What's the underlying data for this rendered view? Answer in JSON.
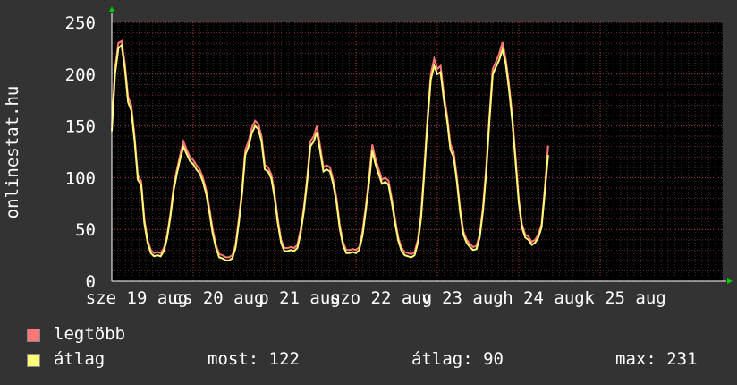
{
  "chart_data": {
    "type": "line",
    "ylabel": "onlinestat.hu",
    "ylim": [
      0,
      250
    ],
    "yticks": [
      0,
      50,
      100,
      150,
      200,
      250
    ],
    "xticks": [
      {
        "text": "sze 19 aug",
        "day": 0
      },
      {
        "text": "cs 20 aug",
        "day": 1
      },
      {
        "text": "p 21 aug",
        "day": 2
      },
      {
        "text": "szo 22 aug",
        "day": 3
      },
      {
        "text": "v 23 aug",
        "day": 4
      },
      {
        "text": "h 24 aug",
        "day": 5
      },
      {
        "text": "k 25 aug",
        "day": 6
      }
    ],
    "grid": true,
    "colors": {
      "background": "#333333",
      "plot_bg": "#000000",
      "grid": "#5a5a5a",
      "minor_grid": "#8a3030",
      "axis": "#ffffff",
      "arrow": "#00cc00",
      "max_series": "#ff7777",
      "avg_series": "#ffff77"
    },
    "series": [
      {
        "name": "legtöbb",
        "color": "#ff7777",
        "points": [
          [
            0.0,
            150
          ],
          [
            0.04,
            205
          ],
          [
            0.08,
            230
          ],
          [
            0.12,
            232
          ],
          [
            0.16,
            210
          ],
          [
            0.2,
            178
          ],
          [
            0.24,
            170
          ],
          [
            0.28,
            140
          ],
          [
            0.32,
            102
          ],
          [
            0.36,
            97
          ],
          [
            0.4,
            60
          ],
          [
            0.44,
            40
          ],
          [
            0.48,
            30
          ],
          [
            0.52,
            27
          ],
          [
            0.56,
            28
          ],
          [
            0.6,
            27
          ],
          [
            0.64,
            32
          ],
          [
            0.68,
            45
          ],
          [
            0.72,
            65
          ],
          [
            0.76,
            92
          ],
          [
            0.8,
            108
          ],
          [
            0.84,
            122
          ],
          [
            0.88,
            135
          ],
          [
            0.92,
            127
          ],
          [
            0.96,
            120
          ],
          [
            1.0,
            117
          ],
          [
            1.04,
            112
          ],
          [
            1.08,
            108
          ],
          [
            1.12,
            100
          ],
          [
            1.16,
            88
          ],
          [
            1.2,
            70
          ],
          [
            1.24,
            50
          ],
          [
            1.28,
            35
          ],
          [
            1.32,
            26
          ],
          [
            1.36,
            25
          ],
          [
            1.4,
            23
          ],
          [
            1.44,
            23
          ],
          [
            1.48,
            25
          ],
          [
            1.52,
            35
          ],
          [
            1.56,
            60
          ],
          [
            1.6,
            88
          ],
          [
            1.64,
            127
          ],
          [
            1.68,
            135
          ],
          [
            1.72,
            148
          ],
          [
            1.76,
            155
          ],
          [
            1.8,
            152
          ],
          [
            1.84,
            140
          ],
          [
            1.88,
            112
          ],
          [
            1.92,
            110
          ],
          [
            1.96,
            103
          ],
          [
            2.0,
            85
          ],
          [
            2.04,
            60
          ],
          [
            2.08,
            40
          ],
          [
            2.12,
            32
          ],
          [
            2.16,
            32
          ],
          [
            2.2,
            33
          ],
          [
            2.24,
            32
          ],
          [
            2.28,
            35
          ],
          [
            2.32,
            50
          ],
          [
            2.36,
            72
          ],
          [
            2.4,
            100
          ],
          [
            2.44,
            135
          ],
          [
            2.48,
            140
          ],
          [
            2.52,
            150
          ],
          [
            2.56,
            130
          ],
          [
            2.6,
            110
          ],
          [
            2.64,
            112
          ],
          [
            2.68,
            110
          ],
          [
            2.72,
            98
          ],
          [
            2.76,
            80
          ],
          [
            2.8,
            55
          ],
          [
            2.84,
            38
          ],
          [
            2.88,
            30
          ],
          [
            2.92,
            30
          ],
          [
            2.96,
            31
          ],
          [
            3.0,
            30
          ],
          [
            3.04,
            33
          ],
          [
            3.08,
            48
          ],
          [
            3.12,
            72
          ],
          [
            3.16,
            100
          ],
          [
            3.2,
            132
          ],
          [
            3.24,
            118
          ],
          [
            3.28,
            108
          ],
          [
            3.32,
            98
          ],
          [
            3.36,
            100
          ],
          [
            3.4,
            97
          ],
          [
            3.44,
            80
          ],
          [
            3.48,
            60
          ],
          [
            3.52,
            42
          ],
          [
            3.56,
            32
          ],
          [
            3.6,
            28
          ],
          [
            3.64,
            27
          ],
          [
            3.68,
            26
          ],
          [
            3.72,
            28
          ],
          [
            3.76,
            40
          ],
          [
            3.8,
            65
          ],
          [
            3.84,
            110
          ],
          [
            3.88,
            160
          ],
          [
            3.92,
            200
          ],
          [
            3.96,
            215
          ],
          [
            4.0,
            205
          ],
          [
            4.04,
            208
          ],
          [
            4.08,
            180
          ],
          [
            4.12,
            160
          ],
          [
            4.16,
            132
          ],
          [
            4.2,
            125
          ],
          [
            4.24,
            100
          ],
          [
            4.28,
            70
          ],
          [
            4.32,
            48
          ],
          [
            4.36,
            40
          ],
          [
            4.4,
            36
          ],
          [
            4.44,
            33
          ],
          [
            4.48,
            34
          ],
          [
            4.52,
            45
          ],
          [
            4.56,
            72
          ],
          [
            4.6,
            110
          ],
          [
            4.64,
            160
          ],
          [
            4.68,
            205
          ],
          [
            4.72,
            212
          ],
          [
            4.76,
            220
          ],
          [
            4.8,
            231
          ],
          [
            4.84,
            215
          ],
          [
            4.88,
            190
          ],
          [
            4.92,
            160
          ],
          [
            4.96,
            120
          ],
          [
            5.0,
            80
          ],
          [
            5.04,
            55
          ],
          [
            5.08,
            45
          ],
          [
            5.12,
            43
          ],
          [
            5.16,
            38
          ],
          [
            5.2,
            40
          ],
          [
            5.24,
            45
          ],
          [
            5.28,
            55
          ],
          [
            5.32,
            90
          ],
          [
            5.36,
            131
          ]
        ]
      },
      {
        "name": "átlag",
        "color": "#ffff77",
        "points": [
          [
            0.0,
            145
          ],
          [
            0.04,
            200
          ],
          [
            0.08,
            225
          ],
          [
            0.12,
            228
          ],
          [
            0.16,
            205
          ],
          [
            0.2,
            173
          ],
          [
            0.24,
            165
          ],
          [
            0.28,
            135
          ],
          [
            0.32,
            98
          ],
          [
            0.36,
            93
          ],
          [
            0.4,
            56
          ],
          [
            0.44,
            37
          ],
          [
            0.48,
            27
          ],
          [
            0.52,
            24
          ],
          [
            0.56,
            25
          ],
          [
            0.6,
            24
          ],
          [
            0.64,
            29
          ],
          [
            0.68,
            42
          ],
          [
            0.72,
            62
          ],
          [
            0.76,
            88
          ],
          [
            0.8,
            104
          ],
          [
            0.84,
            118
          ],
          [
            0.88,
            130
          ],
          [
            0.92,
            123
          ],
          [
            0.96,
            116
          ],
          [
            1.0,
            113
          ],
          [
            1.04,
            108
          ],
          [
            1.08,
            104
          ],
          [
            1.12,
            96
          ],
          [
            1.16,
            84
          ],
          [
            1.2,
            66
          ],
          [
            1.24,
            46
          ],
          [
            1.28,
            32
          ],
          [
            1.32,
            23
          ],
          [
            1.36,
            22
          ],
          [
            1.4,
            20
          ],
          [
            1.44,
            20
          ],
          [
            1.48,
            22
          ],
          [
            1.52,
            32
          ],
          [
            1.56,
            56
          ],
          [
            1.6,
            84
          ],
          [
            1.64,
            122
          ],
          [
            1.68,
            130
          ],
          [
            1.72,
            143
          ],
          [
            1.76,
            150
          ],
          [
            1.8,
            147
          ],
          [
            1.84,
            135
          ],
          [
            1.88,
            108
          ],
          [
            1.92,
            106
          ],
          [
            1.96,
            99
          ],
          [
            2.0,
            81
          ],
          [
            2.04,
            56
          ],
          [
            2.08,
            37
          ],
          [
            2.12,
            29
          ],
          [
            2.16,
            29
          ],
          [
            2.2,
            30
          ],
          [
            2.24,
            29
          ],
          [
            2.28,
            32
          ],
          [
            2.32,
            46
          ],
          [
            2.36,
            68
          ],
          [
            2.4,
            96
          ],
          [
            2.44,
            130
          ],
          [
            2.48,
            135
          ],
          [
            2.52,
            144
          ],
          [
            2.56,
            125
          ],
          [
            2.6,
            106
          ],
          [
            2.64,
            108
          ],
          [
            2.68,
            106
          ],
          [
            2.72,
            94
          ],
          [
            2.76,
            76
          ],
          [
            2.8,
            51
          ],
          [
            2.84,
            35
          ],
          [
            2.88,
            27
          ],
          [
            2.92,
            27
          ],
          [
            2.96,
            28
          ],
          [
            3.0,
            27
          ],
          [
            3.04,
            30
          ],
          [
            3.08,
            44
          ],
          [
            3.12,
            68
          ],
          [
            3.16,
            95
          ],
          [
            3.2,
            126
          ],
          [
            3.24,
            113
          ],
          [
            3.28,
            103
          ],
          [
            3.32,
            94
          ],
          [
            3.36,
            96
          ],
          [
            3.4,
            93
          ],
          [
            3.44,
            76
          ],
          [
            3.48,
            56
          ],
          [
            3.52,
            39
          ],
          [
            3.56,
            29
          ],
          [
            3.6,
            25
          ],
          [
            3.64,
            24
          ],
          [
            3.68,
            23
          ],
          [
            3.72,
            25
          ],
          [
            3.76,
            37
          ],
          [
            3.8,
            61
          ],
          [
            3.84,
            105
          ],
          [
            3.88,
            155
          ],
          [
            3.92,
            195
          ],
          [
            3.96,
            208
          ],
          [
            4.0,
            200
          ],
          [
            4.04,
            202
          ],
          [
            4.08,
            175
          ],
          [
            4.12,
            155
          ],
          [
            4.16,
            127
          ],
          [
            4.2,
            120
          ],
          [
            4.24,
            96
          ],
          [
            4.28,
            66
          ],
          [
            4.32,
            45
          ],
          [
            4.36,
            37
          ],
          [
            4.4,
            33
          ],
          [
            4.44,
            30
          ],
          [
            4.48,
            31
          ],
          [
            4.52,
            42
          ],
          [
            4.56,
            68
          ],
          [
            4.6,
            105
          ],
          [
            4.64,
            155
          ],
          [
            4.68,
            200
          ],
          [
            4.72,
            207
          ],
          [
            4.76,
            214
          ],
          [
            4.8,
            224
          ],
          [
            4.84,
            210
          ],
          [
            4.88,
            185
          ],
          [
            4.92,
            155
          ],
          [
            4.96,
            115
          ],
          [
            5.0,
            76
          ],
          [
            5.04,
            52
          ],
          [
            5.08,
            42
          ],
          [
            5.12,
            40
          ],
          [
            5.16,
            35
          ],
          [
            5.2,
            37
          ],
          [
            5.24,
            42
          ],
          [
            5.28,
            52
          ],
          [
            5.32,
            86
          ],
          [
            5.36,
            122
          ]
        ]
      }
    ]
  },
  "legend": {
    "items": [
      {
        "label": "legtöbb",
        "color": "#ff7777"
      },
      {
        "label": "átlag",
        "color": "#ffff77"
      }
    ]
  },
  "stats": {
    "now": "most: 122",
    "avg": "átlag: 90",
    "max": "max: 231"
  }
}
